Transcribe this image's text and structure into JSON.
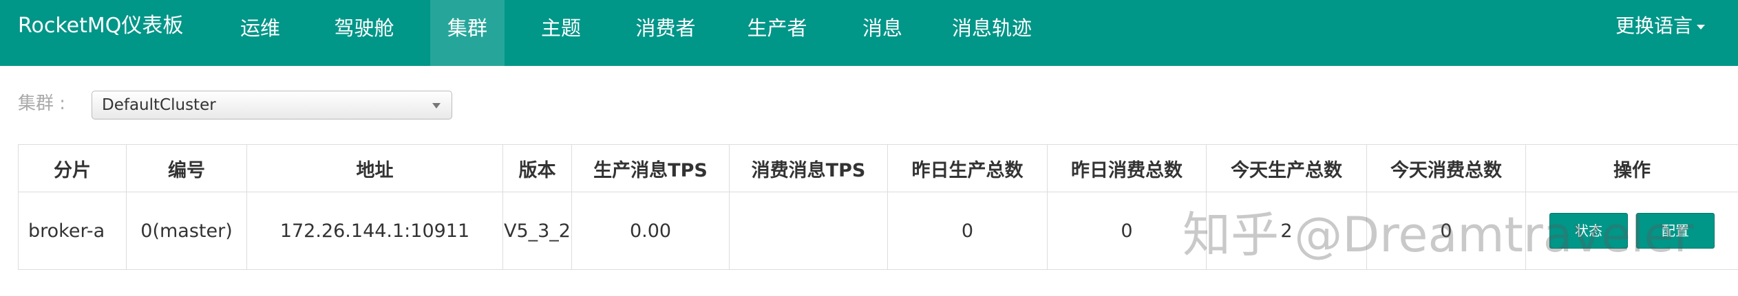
{
  "header": {
    "brand": "RocketMQ仪表板",
    "nav": [
      "运维",
      "驾驶舱",
      "集群",
      "主题",
      "消费者",
      "生产者",
      "消息",
      "消息轨迹"
    ],
    "active_nav": "集群",
    "language_menu": "更换语言"
  },
  "filter": {
    "label": "集群 :",
    "selected_cluster": "DefaultCluster"
  },
  "table": {
    "headers": [
      "分片",
      "编号",
      "地址",
      "版本",
      "生产消息TPS",
      "消费消息TPS",
      "昨日生产总数",
      "昨日消费总数",
      "今天生产总数",
      "今天消费总数",
      "操作"
    ],
    "rows": [
      {
        "shard": "broker-a",
        "number": "0(master)",
        "address": "172.26.144.1:10911",
        "version": "V5_3_2",
        "produce_tps": "0.00",
        "consume_tps": "",
        "yesterday_produced": "0",
        "yesterday_consumed": "0",
        "today_produced": "2",
        "today_consumed": "0",
        "actions": [
          "状态",
          "配置"
        ]
      }
    ]
  },
  "watermark": "知乎 @Dreamtraveler",
  "colors": {
    "primary": "#009688",
    "active_nav": "#26a69a"
  }
}
